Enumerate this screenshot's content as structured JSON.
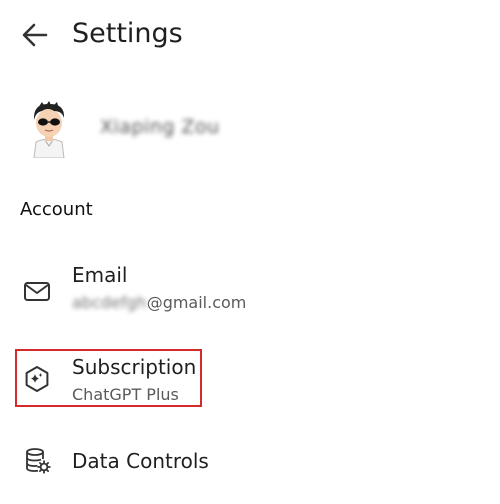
{
  "header": {
    "title": "Settings",
    "back_icon": "arrow-left-icon"
  },
  "profile": {
    "name": "Xiaping Zou",
    "avatar_icon": "avatar-cartoon-sunglasses"
  },
  "account": {
    "header": "Account",
    "items": [
      {
        "icon": "mail-icon",
        "label": "Email",
        "value_masked": "abcdefgh",
        "value_domain": "@gmail.com"
      },
      {
        "icon": "subscription-hexagon-icon",
        "label": "Subscription",
        "value": "ChatGPT Plus",
        "highlight_color": "#d42a2a"
      },
      {
        "icon": "database-gear-icon",
        "label": "Data Controls"
      }
    ]
  }
}
